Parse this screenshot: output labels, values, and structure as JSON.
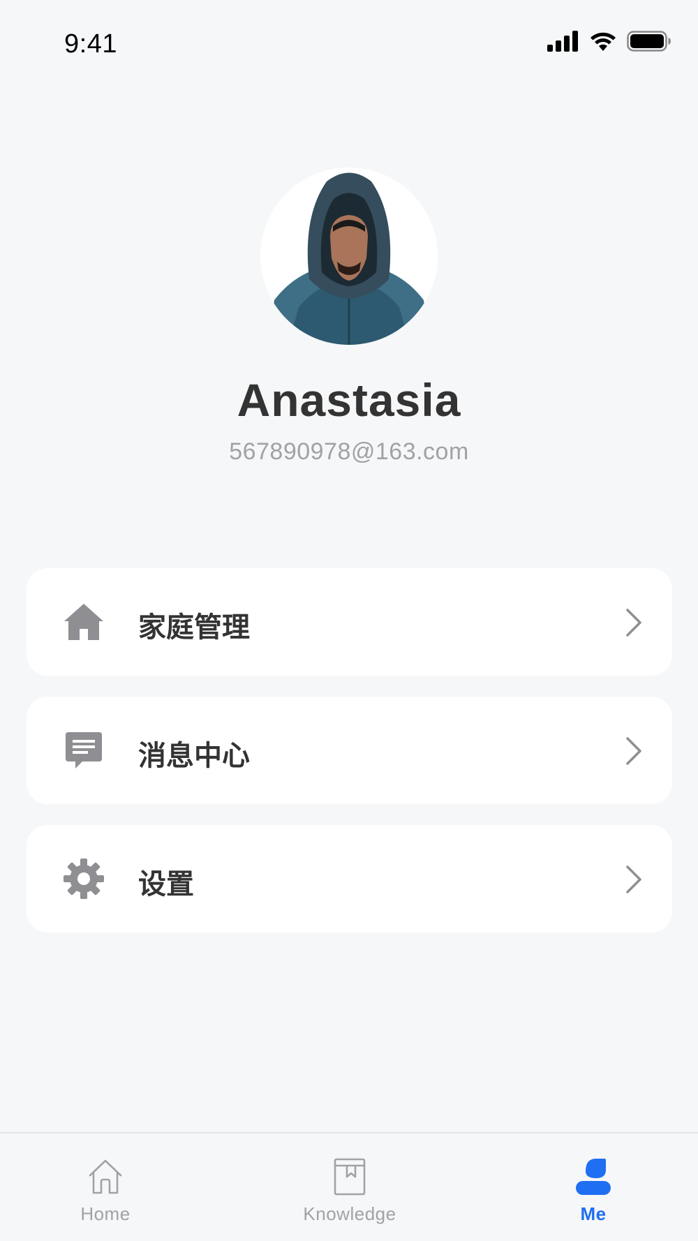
{
  "status_bar": {
    "time": "9:41",
    "icons": [
      "signal-icon",
      "wifi-icon",
      "battery-icon"
    ]
  },
  "profile": {
    "name": "Anastasia",
    "email": "567890978@163.com",
    "avatar_icon": "avatar-photo"
  },
  "menu": [
    {
      "label": "家庭管理",
      "icon": "home-icon"
    },
    {
      "label": "消息中心",
      "icon": "message-icon"
    },
    {
      "label": "设置",
      "icon": "gear-icon"
    }
  ],
  "tabs": [
    {
      "label": "Home",
      "icon": "home-outline-icon",
      "active": false
    },
    {
      "label": "Knowledge",
      "icon": "book-icon",
      "active": false
    },
    {
      "label": "Me",
      "icon": "user-icon",
      "active": true
    }
  ],
  "colors": {
    "background": "#f6f7f9",
    "card": "#ffffff",
    "text_primary": "#333333",
    "text_secondary": "#a0a2a6",
    "icon_gray": "#8e8e93",
    "accent": "#1f6ff2"
  }
}
